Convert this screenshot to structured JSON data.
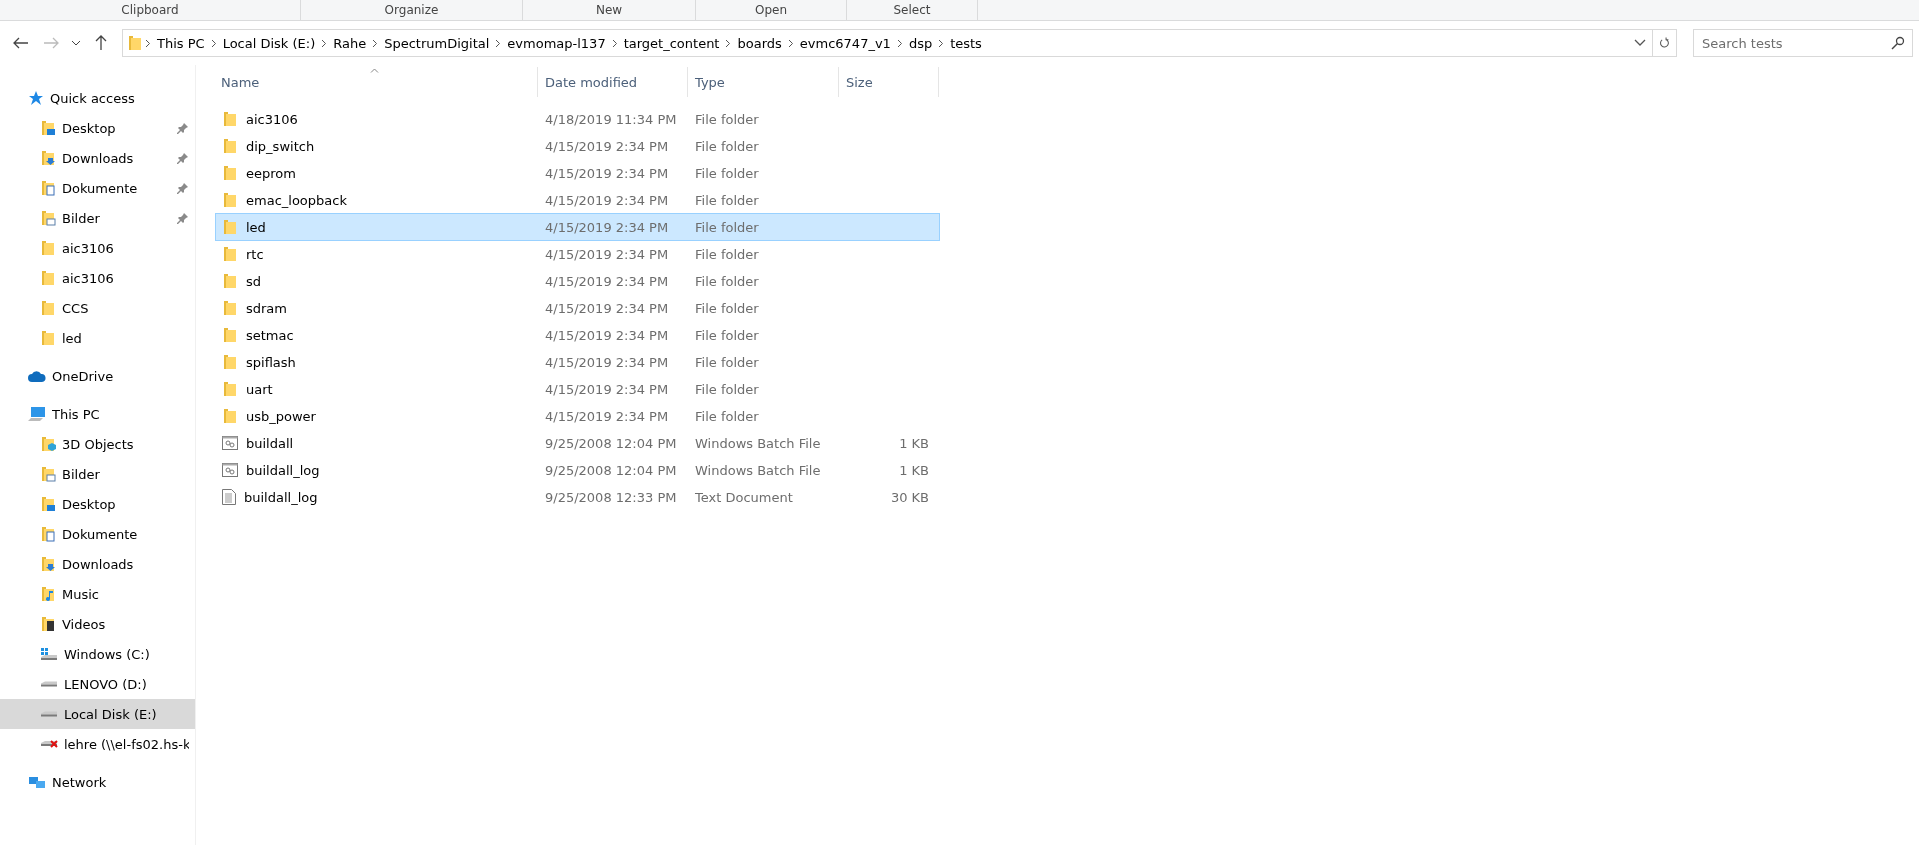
{
  "ribbon_groups": [
    "Clipboard",
    "Organize",
    "New",
    "Open",
    "Select"
  ],
  "address_bar": {
    "segments": [
      "This PC",
      "Local Disk (E:)",
      "Rahe",
      "SpectrumDigital",
      "evmomap-l137",
      "target_content",
      "boards",
      "evmc6747_v1",
      "dsp",
      "tests"
    ]
  },
  "search": {
    "placeholder": "Search tests"
  },
  "sidebar": {
    "items": [
      {
        "label": "Quick access",
        "kind": "quick",
        "selected": false,
        "children": [
          {
            "label": "Desktop",
            "kind": "desktop",
            "pinned": true,
            "selected": false
          },
          {
            "label": "Downloads",
            "kind": "downloads",
            "pinned": true,
            "selected": false
          },
          {
            "label": "Dokumente",
            "kind": "documents",
            "pinned": true,
            "selected": false
          },
          {
            "label": "Bilder",
            "kind": "pictures",
            "pinned": true,
            "selected": false
          },
          {
            "label": "aic3106",
            "kind": "folder",
            "pinned": false,
            "selected": false
          },
          {
            "label": "aic3106",
            "kind": "folder",
            "pinned": false,
            "selected": false
          },
          {
            "label": "CCS",
            "kind": "folder",
            "pinned": false,
            "selected": false
          },
          {
            "label": "led",
            "kind": "folder",
            "pinned": false,
            "selected": false
          }
        ]
      },
      {
        "label": "OneDrive",
        "kind": "cloud",
        "selected": false
      },
      {
        "label": "This PC",
        "kind": "pc",
        "selected": false,
        "children": [
          {
            "label": "3D Objects",
            "kind": "objects",
            "pinned": false,
            "selected": false
          },
          {
            "label": "Bilder",
            "kind": "pictures",
            "pinned": false,
            "selected": false
          },
          {
            "label": "Desktop",
            "kind": "desktop",
            "pinned": false,
            "selected": false
          },
          {
            "label": "Dokumente",
            "kind": "documents",
            "pinned": false,
            "selected": false
          },
          {
            "label": "Downloads",
            "kind": "downloads",
            "pinned": false,
            "selected": false
          },
          {
            "label": "Music",
            "kind": "music",
            "pinned": false,
            "selected": false
          },
          {
            "label": "Videos",
            "kind": "videos",
            "pinned": false,
            "selected": false
          },
          {
            "label": "Windows (C:)",
            "kind": "windrive",
            "pinned": false,
            "selected": false
          },
          {
            "label": "LENOVO (D:)",
            "kind": "drive",
            "pinned": false,
            "selected": false
          },
          {
            "label": "Local Disk (E:)",
            "kind": "drive",
            "pinned": false,
            "selected": true
          },
          {
            "label": "lehre (\\\\el-fs02.hs-k",
            "kind": "netdrive",
            "pinned": false,
            "selected": false
          }
        ]
      },
      {
        "label": "Network",
        "kind": "network",
        "selected": false
      }
    ]
  },
  "table": {
    "columns": [
      "Name",
      "Date modified",
      "Type",
      "Size"
    ],
    "rows": [
      {
        "name": "aic3106",
        "date": "4/18/2019 11:34 PM",
        "type": "File folder",
        "kind": "folder",
        "selected": false
      },
      {
        "name": "dip_switch",
        "date": "4/15/2019 2:34 PM",
        "type": "File folder",
        "kind": "folder",
        "selected": false
      },
      {
        "name": "eeprom",
        "date": "4/15/2019 2:34 PM",
        "type": "File folder",
        "kind": "folder",
        "selected": false
      },
      {
        "name": "emac_loopback",
        "date": "4/15/2019 2:34 PM",
        "type": "File folder",
        "kind": "folder",
        "selected": false
      },
      {
        "name": "led",
        "date": "4/15/2019 2:34 PM",
        "type": "File folder",
        "kind": "folder",
        "selected": true
      },
      {
        "name": "rtc",
        "date": "4/15/2019 2:34 PM",
        "type": "File folder",
        "kind": "folder",
        "selected": false
      },
      {
        "name": "sd",
        "date": "4/15/2019 2:34 PM",
        "type": "File folder",
        "kind": "folder",
        "selected": false
      },
      {
        "name": "sdram",
        "date": "4/15/2019 2:34 PM",
        "type": "File folder",
        "kind": "folder",
        "selected": false
      },
      {
        "name": "setmac",
        "date": "4/15/2019 2:34 PM",
        "type": "File folder",
        "kind": "folder",
        "selected": false
      },
      {
        "name": "spiflash",
        "date": "4/15/2019 2:34 PM",
        "type": "File folder",
        "kind": "folder",
        "selected": false
      },
      {
        "name": "uart",
        "date": "4/15/2019 2:34 PM",
        "type": "File folder",
        "kind": "folder",
        "selected": false
      },
      {
        "name": "usb_power",
        "date": "4/15/2019 2:34 PM",
        "type": "File folder",
        "kind": "folder",
        "selected": false
      },
      {
        "name": "buildall",
        "date": "9/25/2008 12:04 PM",
        "type": "Windows Batch File",
        "size": "1 KB",
        "kind": "batch",
        "selected": false
      },
      {
        "name": "buildall_log",
        "date": "9/25/2008 12:04 PM",
        "type": "Windows Batch File",
        "size": "1 KB",
        "kind": "batch",
        "selected": false
      },
      {
        "name": "buildall_log",
        "date": "9/25/2008 12:33 PM",
        "type": "Text Document",
        "size": "30 KB",
        "kind": "text",
        "selected": false
      }
    ]
  }
}
